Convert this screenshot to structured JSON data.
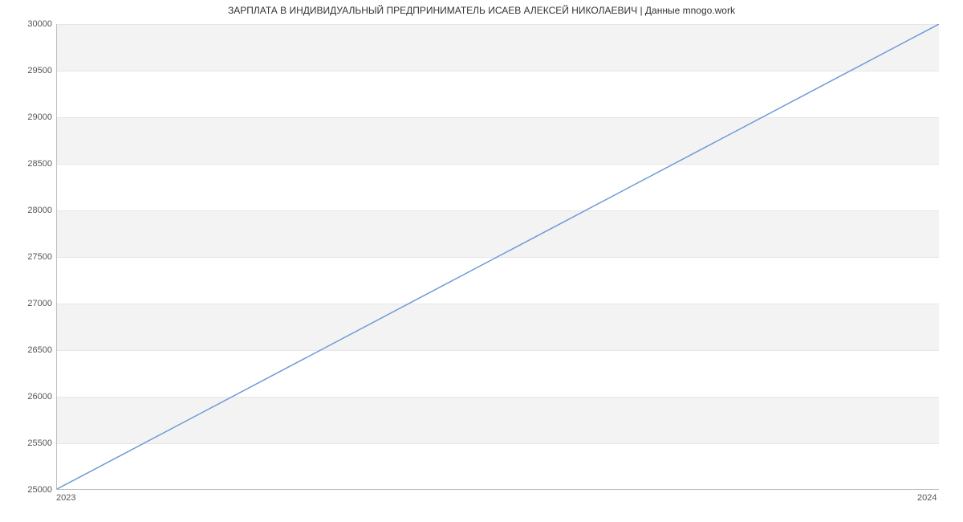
{
  "chart_data": {
    "type": "line",
    "title": "ЗАРПЛАТА В ИНДИВИДУАЛЬНЫЙ ПРЕДПРИНИМАТЕЛЬ ИСАЕВ АЛЕКСЕЙ НИКОЛАЕВИЧ | Данные mnogo.work",
    "x": [
      2023,
      2024
    ],
    "values": [
      25000,
      30000
    ],
    "xlabel": "",
    "ylabel": "",
    "ylim": [
      25000,
      30000
    ],
    "xticks": [
      "2023",
      "2024"
    ],
    "yticks": [
      "25000",
      "25500",
      "26000",
      "26500",
      "27000",
      "27500",
      "28000",
      "28500",
      "29000",
      "29500",
      "30000"
    ],
    "grid": true,
    "line_color": "#6f9bd8"
  }
}
